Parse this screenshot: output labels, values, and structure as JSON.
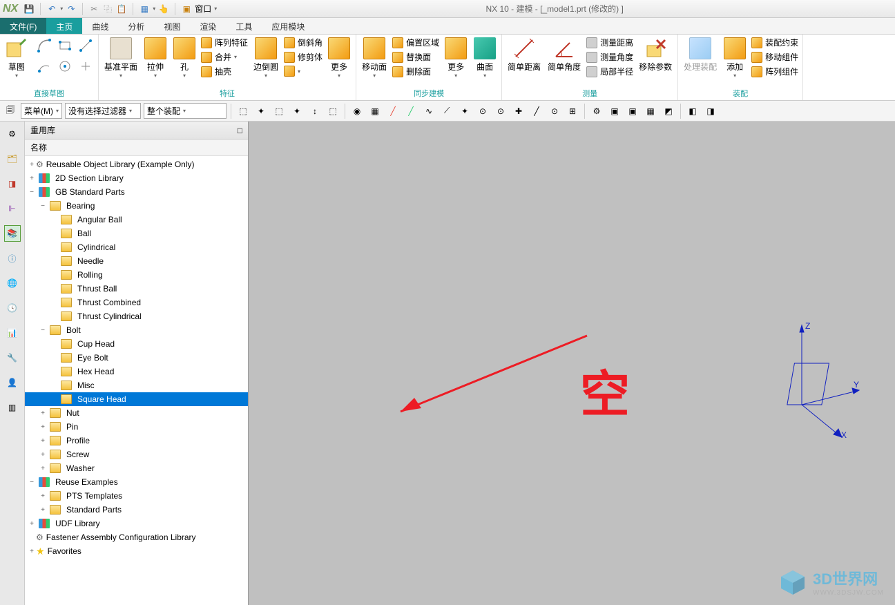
{
  "title": "NX 10 - 建模 - [_model1.prt  (修改的)  ]",
  "app_logo": "NX",
  "qat": {
    "window_label": "窗口"
  },
  "menu": {
    "file": "文件(F)",
    "home": "主页",
    "curve": "曲线",
    "analysis": "分析",
    "view": "视图",
    "render": "渲染",
    "tools": "工具",
    "app": "应用模块"
  },
  "ribbon": {
    "sketch": {
      "btn": "草图",
      "group": "直接草图"
    },
    "feature": {
      "datum_plane": "基准平面",
      "extrude": "拉伸",
      "hole": "孔",
      "pattern": "阵列特征",
      "unite": "合并",
      "shell": "抽壳",
      "edge_blend": "边倒圆",
      "chamfer": "倒斜角",
      "trim_body": "修剪体",
      "more": "更多",
      "group": "特征"
    },
    "sync": {
      "move_face": "移动面",
      "offset_region": "偏置区域",
      "replace_face": "替换面",
      "delete_face": "删除面",
      "more": "更多",
      "surface": "曲面",
      "group": "同步建模"
    },
    "measure": {
      "simple_dist": "简单距离",
      "simple_angle": "简单角度",
      "measure_dist": "测量距离",
      "measure_angle": "测量角度",
      "local_radius": "局部半径",
      "delete_param": "移除参数",
      "group": "测量"
    },
    "assembly": {
      "process_asm": "处理装配",
      "add": "添加",
      "asm_const": "装配约束",
      "move_comp": "移动组件",
      "array_comp": "阵列组件",
      "group": "装配"
    }
  },
  "toolbar2": {
    "menu_btn": "菜单(M)",
    "filter1": "没有选择过滤器",
    "filter2": "整个装配"
  },
  "panel": {
    "title": "重用库",
    "col_name": "名称",
    "close": "□"
  },
  "tree": {
    "items": [
      {
        "ind": 0,
        "t": "+",
        "ic": "gear",
        "label": "Reusable Object Library (Example Only)"
      },
      {
        "ind": 0,
        "t": "+",
        "ic": "lib",
        "label": "2D Section Library"
      },
      {
        "ind": 0,
        "t": "−",
        "ic": "lib",
        "label": "GB Standard Parts"
      },
      {
        "ind": 1,
        "t": "−",
        "ic": "folder",
        "label": "Bearing"
      },
      {
        "ind": 2,
        "t": "",
        "ic": "folder",
        "label": "Angular Ball"
      },
      {
        "ind": 2,
        "t": "",
        "ic": "folder",
        "label": "Ball"
      },
      {
        "ind": 2,
        "t": "",
        "ic": "folder",
        "label": "Cylindrical"
      },
      {
        "ind": 2,
        "t": "",
        "ic": "folder",
        "label": "Needle"
      },
      {
        "ind": 2,
        "t": "",
        "ic": "folder",
        "label": "Rolling"
      },
      {
        "ind": 2,
        "t": "",
        "ic": "folder",
        "label": "Thrust Ball"
      },
      {
        "ind": 2,
        "t": "",
        "ic": "folder",
        "label": "Thrust Combined"
      },
      {
        "ind": 2,
        "t": "",
        "ic": "folder",
        "label": "Thrust Cylindrical"
      },
      {
        "ind": 1,
        "t": "−",
        "ic": "folder",
        "label": "Bolt"
      },
      {
        "ind": 2,
        "t": "",
        "ic": "folder",
        "label": "Cup Head"
      },
      {
        "ind": 2,
        "t": "",
        "ic": "folder",
        "label": "Eye Bolt"
      },
      {
        "ind": 2,
        "t": "",
        "ic": "folder",
        "label": "Hex Head"
      },
      {
        "ind": 2,
        "t": "",
        "ic": "folder",
        "label": "Misc"
      },
      {
        "ind": 2,
        "t": "",
        "ic": "folder",
        "label": "Square Head",
        "sel": true
      },
      {
        "ind": 1,
        "t": "+",
        "ic": "folder",
        "label": "Nut"
      },
      {
        "ind": 1,
        "t": "+",
        "ic": "folder",
        "label": "Pin"
      },
      {
        "ind": 1,
        "t": "+",
        "ic": "folder",
        "label": "Profile"
      },
      {
        "ind": 1,
        "t": "+",
        "ic": "folder",
        "label": "Screw"
      },
      {
        "ind": 1,
        "t": "+",
        "ic": "folder",
        "label": "Washer"
      },
      {
        "ind": 0,
        "t": "−",
        "ic": "lib",
        "label": "Reuse Examples"
      },
      {
        "ind": 1,
        "t": "+",
        "ic": "folder",
        "label": "PTS Templates"
      },
      {
        "ind": 1,
        "t": "+",
        "ic": "folder",
        "label": "Standard Parts"
      },
      {
        "ind": 0,
        "t": "+",
        "ic": "lib",
        "label": "UDF Library"
      },
      {
        "ind": 0,
        "t": "",
        "ic": "gear",
        "label": "Fastener Assembly Configuration Library"
      },
      {
        "ind": 0,
        "t": "+",
        "ic": "star",
        "label": "Favorites"
      }
    ]
  },
  "annotation": {
    "text": "空"
  },
  "coords": {
    "x": "X",
    "y": "Y",
    "z": "Z"
  },
  "watermark": {
    "text": "3D世界网",
    "sub": "WWW.3DSJW.COM"
  }
}
